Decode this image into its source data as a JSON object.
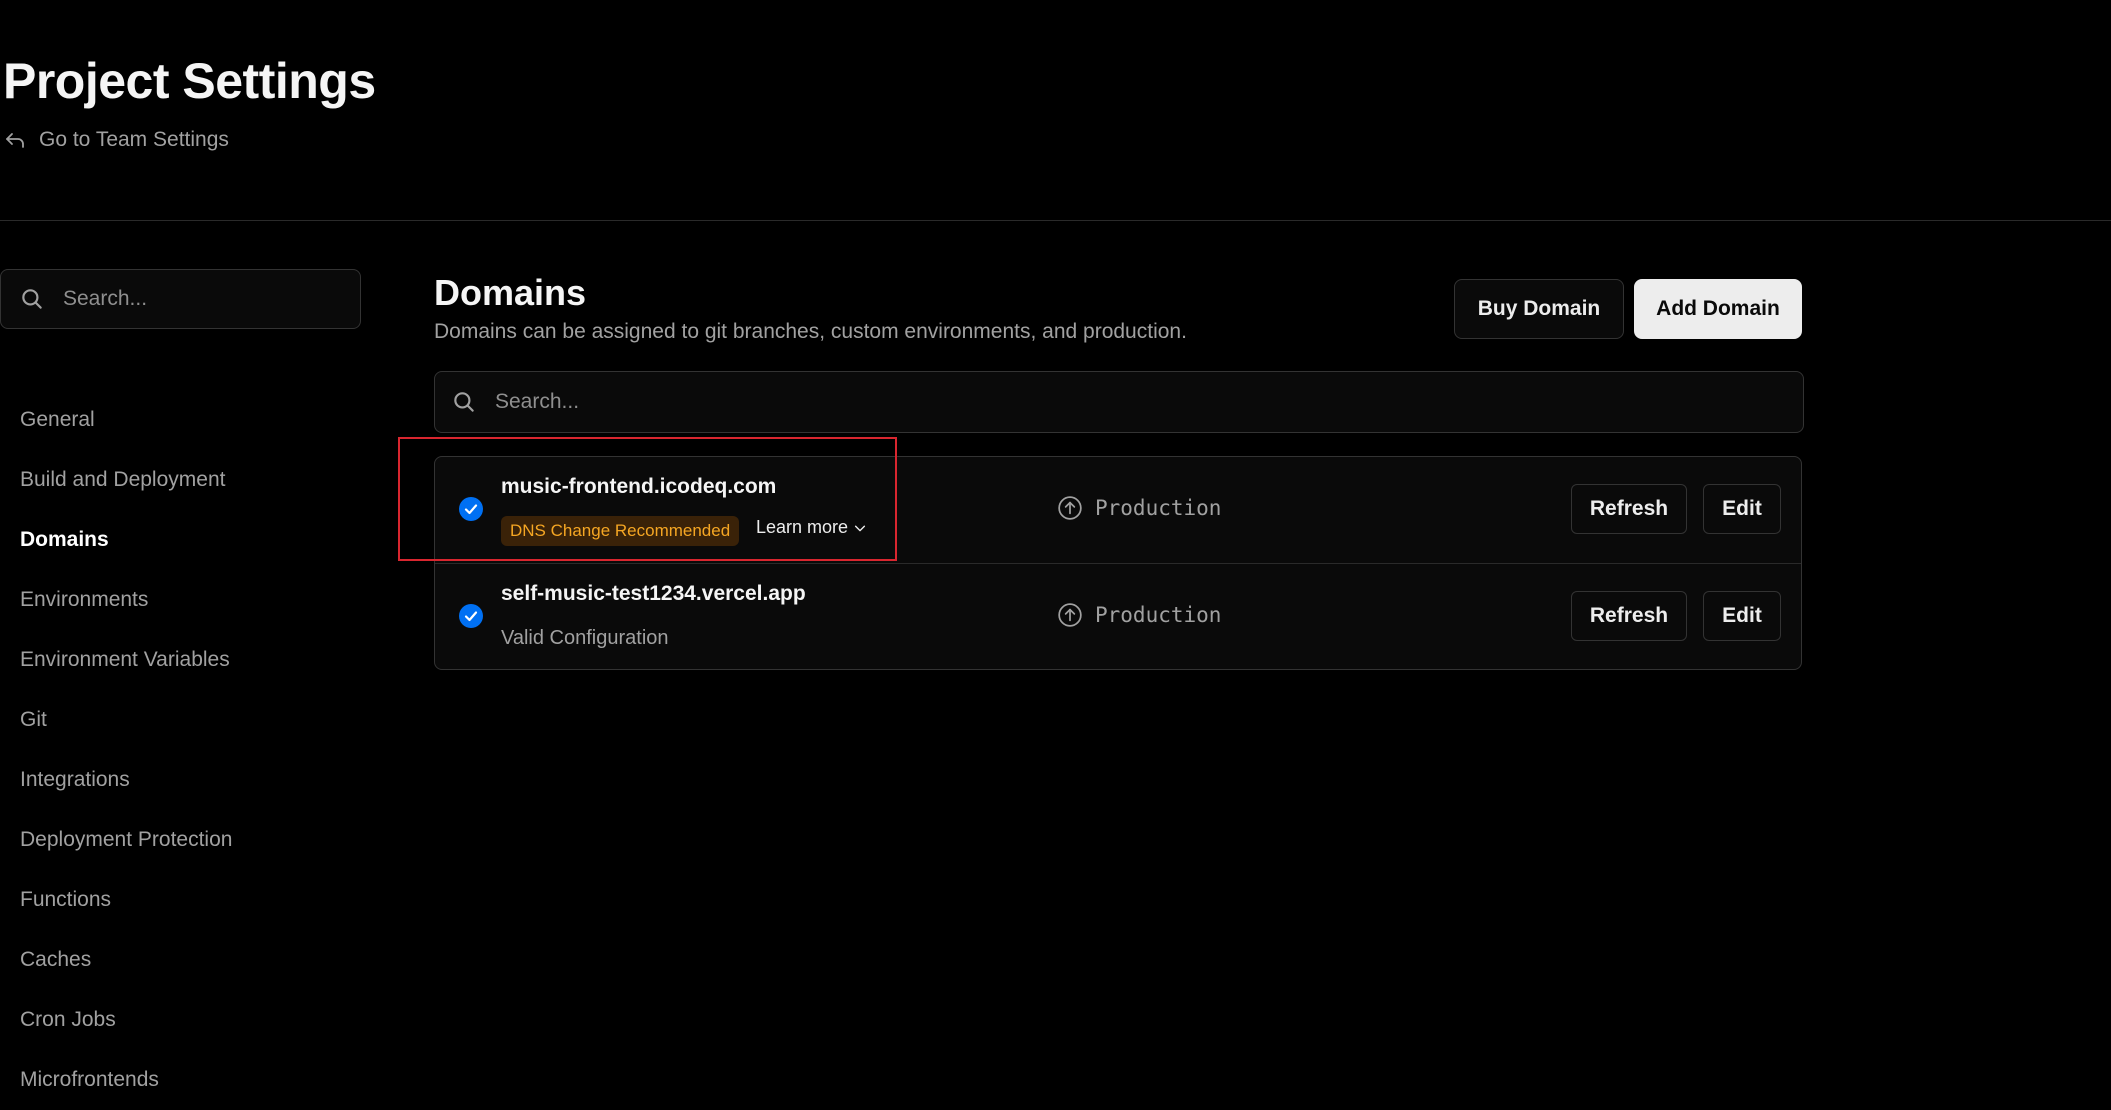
{
  "header": {
    "title": "Project Settings",
    "back_link": "Go to Team Settings"
  },
  "sidebar": {
    "search_placeholder": "Search...",
    "items": [
      {
        "label": "General"
      },
      {
        "label": "Build and Deployment"
      },
      {
        "label": "Domains",
        "active": true
      },
      {
        "label": "Environments"
      },
      {
        "label": "Environment Variables"
      },
      {
        "label": "Git"
      },
      {
        "label": "Integrations"
      },
      {
        "label": "Deployment Protection"
      },
      {
        "label": "Functions"
      },
      {
        "label": "Caches"
      },
      {
        "label": "Cron Jobs"
      },
      {
        "label": "Microfrontends"
      }
    ]
  },
  "main": {
    "title": "Domains",
    "description": "Domains can be assigned to git branches, custom environments, and production.",
    "buy_domain_label": "Buy Domain",
    "add_domain_label": "Add Domain",
    "search_placeholder": "Search...",
    "domains": [
      {
        "name": "music-frontend.icodeq.com",
        "badge": "DNS Change Recommended",
        "learn_more": "Learn more",
        "environment": "Production",
        "refresh_label": "Refresh",
        "edit_label": "Edit"
      },
      {
        "name": "self-music-test1234.vercel.app",
        "status": "Valid Configuration",
        "environment": "Production",
        "refresh_label": "Refresh",
        "edit_label": "Edit"
      }
    ]
  },
  "colors": {
    "background": "#000000",
    "check_blue": "#0070f3",
    "badge_text": "#f5a623",
    "badge_bg": "#3a2208",
    "highlight": "#d9262f"
  }
}
